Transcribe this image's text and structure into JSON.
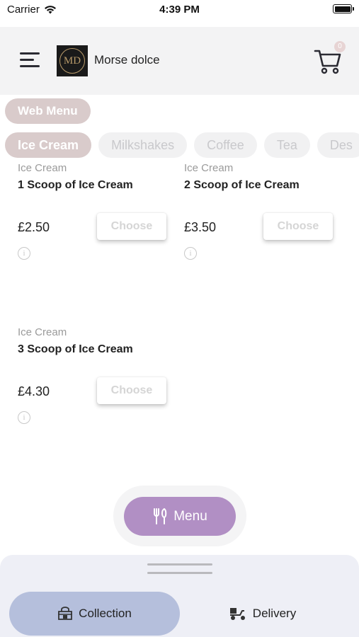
{
  "status_bar": {
    "carrier": "Carrier",
    "time": "4:39 PM"
  },
  "header": {
    "store_name": "Morse dolce",
    "logo_text": "MD",
    "cart_count": "0"
  },
  "web_menu_label": "Web Menu",
  "categories": [
    {
      "label": "Ice Cream",
      "active": true
    },
    {
      "label": "Milkshakes",
      "active": false
    },
    {
      "label": "Coffee",
      "active": false
    },
    {
      "label": "Tea",
      "active": false
    },
    {
      "label": "Des",
      "active": false
    }
  ],
  "products": [
    {
      "category": "Ice Cream",
      "title": "1 Scoop of Ice Cream",
      "price": "£2.50",
      "button": "Choose"
    },
    {
      "category": "Ice Cream",
      "title": "2 Scoop of Ice Cream",
      "price": "£3.50",
      "button": "Choose"
    },
    {
      "category": "Ice Cream",
      "title": "3 Scoop of Ice Cream",
      "price": "£4.30",
      "button": "Choose"
    }
  ],
  "info_glyph": "i",
  "fab": {
    "label": "Menu"
  },
  "order_options": {
    "collection": "Collection",
    "delivery": "Delivery",
    "selected": "collection"
  },
  "colors": {
    "accent_purple": "#b18fc4",
    "pill_active": "#d9cbcb",
    "selected_option": "#b5bfdc"
  }
}
